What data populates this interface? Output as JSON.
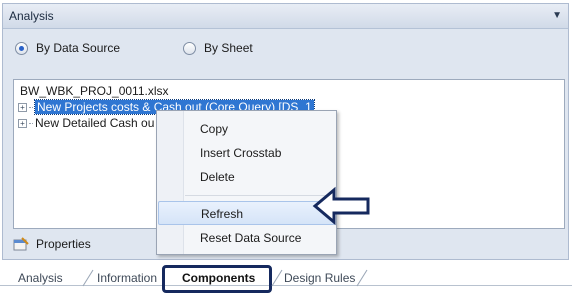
{
  "panel": {
    "title": "Analysis",
    "radio_data_source": "By Data Source",
    "radio_sheet": "By Sheet",
    "selected_option": "By Data Source"
  },
  "tree": {
    "file_name": "BW_WBK_PROJ_0011.xlsx",
    "items": [
      "New Projects costs & Cash out (Core Query) [DS_1",
      "New Detailed Cash ou"
    ]
  },
  "properties_label": "Properties",
  "context_menu": {
    "items": [
      "Copy",
      "Insert Crosstab",
      "Delete",
      "Refresh",
      "Reset Data Source"
    ],
    "highlighted": "Refresh"
  },
  "tabs": [
    "Analysis",
    "Information",
    "Components",
    "Design Rules"
  ],
  "active_tab": "Components",
  "colors": {
    "selection": "#2f76d2",
    "callout": "#15295e"
  }
}
